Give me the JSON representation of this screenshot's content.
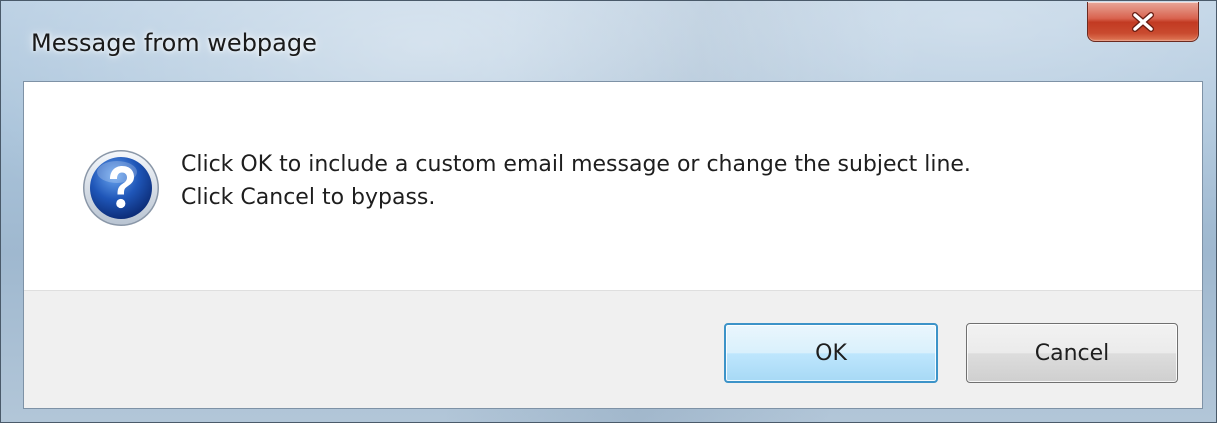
{
  "window": {
    "title": "Message from webpage"
  },
  "titlebar": {
    "close_icon": "close-x-icon",
    "close_color": "#c94a2f"
  },
  "message": {
    "icon": "question-icon",
    "icon_color": "#1f56b8",
    "line1": "Click OK to include a custom email message or change the subject line.",
    "line2": "Click Cancel to bypass."
  },
  "buttons": {
    "ok_label": "OK",
    "cancel_label": "Cancel"
  }
}
